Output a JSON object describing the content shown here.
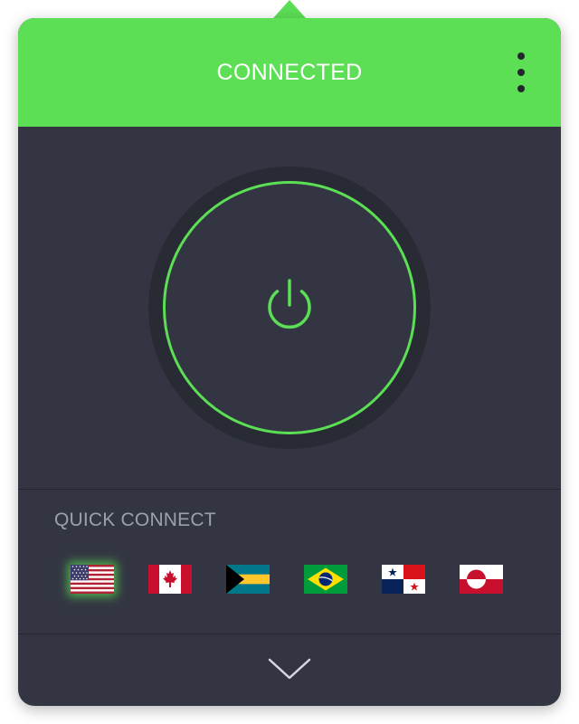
{
  "header": {
    "status": "CONNECTED",
    "menu_icon": "vertical-dots-icon"
  },
  "power": {
    "icon": "power-icon",
    "state": "connected"
  },
  "quick_connect": {
    "label": "QUICK CONNECT",
    "flags": [
      {
        "country": "united-states",
        "icon": "us-flag-icon",
        "selected": true
      },
      {
        "country": "canada",
        "icon": "canada-flag-icon",
        "selected": false
      },
      {
        "country": "bahamas",
        "icon": "bahamas-flag-icon",
        "selected": false
      },
      {
        "country": "brazil",
        "icon": "brazil-flag-icon",
        "selected": false
      },
      {
        "country": "panama",
        "icon": "panama-flag-icon",
        "selected": false
      },
      {
        "country": "greenland",
        "icon": "greenland-flag-icon",
        "selected": false
      }
    ]
  },
  "footer": {
    "expand_icon": "chevron-down-icon"
  },
  "colors": {
    "accent": "#5cde55",
    "panel": "#333642",
    "ring": "#282b33",
    "muted_text": "#9aa0ac"
  }
}
